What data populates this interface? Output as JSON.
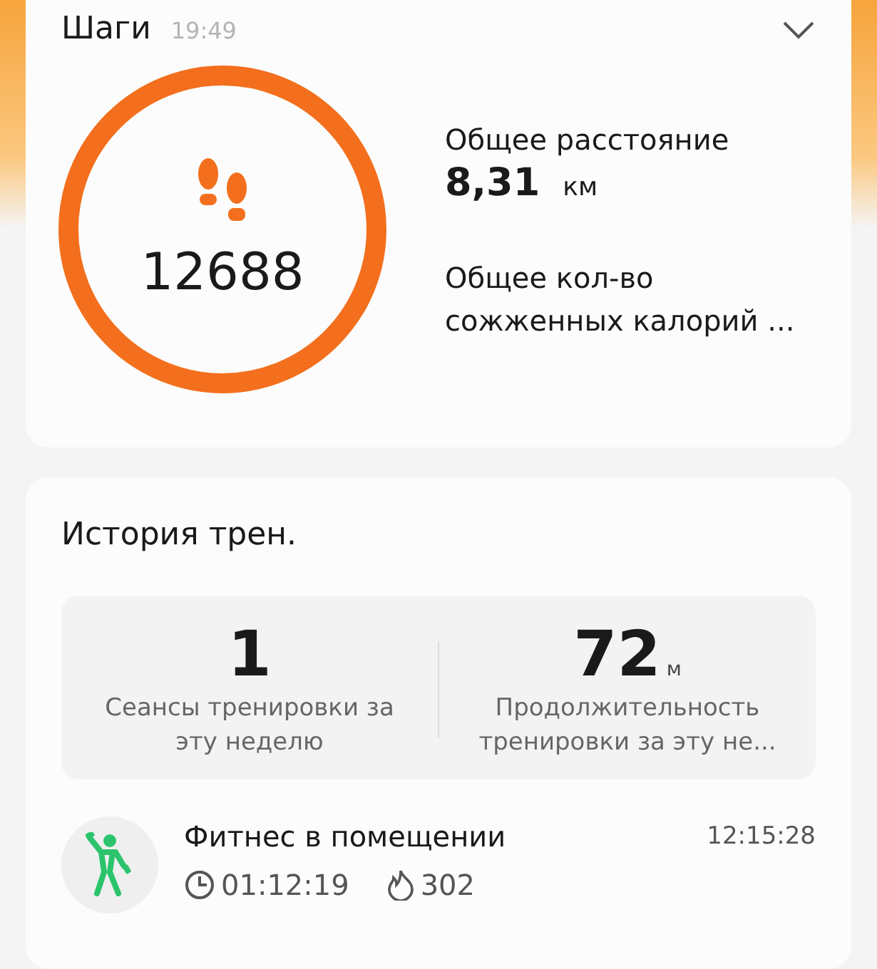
{
  "steps_card": {
    "title": "Шаги",
    "time": "19:49",
    "steps": "12688",
    "distance": {
      "label": "Общее расстояние",
      "value": "8,31",
      "unit": "км"
    },
    "calories": {
      "label": "Общее кол-во сожженных калорий ..."
    }
  },
  "history_card": {
    "title": "История трен.",
    "stats": [
      {
        "value": "1",
        "label": "Сеансы тренировки за эту неделю"
      },
      {
        "value": "72",
        "unit": "м",
        "label": "Продолжительность тренировки за эту не..."
      }
    ],
    "workouts": [
      {
        "name": "Фитнес в помещении",
        "time": "12:15:28",
        "duration": "01:12:19",
        "calories": "302"
      }
    ]
  }
}
